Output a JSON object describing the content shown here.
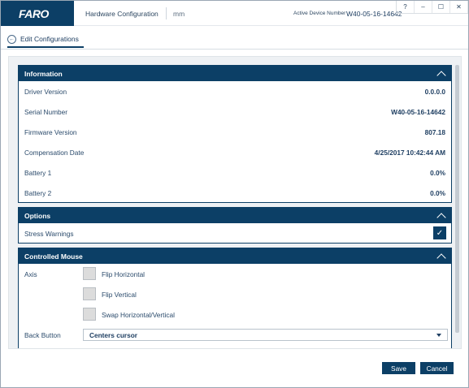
{
  "app": {
    "logo": "FARO",
    "title": "Hardware Configuration",
    "units": "mm",
    "device_label": "Active Device Number",
    "device_value": "W40-05-16-14642"
  },
  "window_controls": [
    "?",
    "–",
    "☐",
    "✕"
  ],
  "tab": {
    "label": "Edit Configurations",
    "icon": "back-arrow-icon"
  },
  "information": {
    "title": "Information",
    "rows": [
      {
        "label": "Driver Version",
        "value": "0.0.0.0"
      },
      {
        "label": "Serial Number",
        "value": "W40-05-16-14642"
      },
      {
        "label": "Firmware Version",
        "value": "807.18"
      },
      {
        "label": "Compensation Date",
        "value": "4/25/2017 10:42:44 AM"
      },
      {
        "label": "Battery 1",
        "value": "0.0%"
      },
      {
        "label": "Battery 2",
        "value": "0.0%"
      }
    ]
  },
  "options": {
    "title": "Options",
    "stress_warnings_label": "Stress Warnings",
    "stress_warnings_checked": true
  },
  "controlled_mouse": {
    "title": "Controlled Mouse",
    "axis_label": "Axis",
    "axis_options": [
      {
        "label": "Flip Horizontal",
        "checked": false
      },
      {
        "label": "Flip Vertical",
        "checked": false
      },
      {
        "label": "Swap Horizontal/Vertical",
        "checked": false
      }
    ],
    "back_button_label": "Back Button",
    "back_button_value": "Centers cursor"
  },
  "footer": {
    "save_label": "Save",
    "cancel_label": "Cancel"
  },
  "colors": {
    "brand": "#0c3f66",
    "checkbox_unchecked": "#dcdcdc",
    "content_bg": "#eef1f4"
  }
}
